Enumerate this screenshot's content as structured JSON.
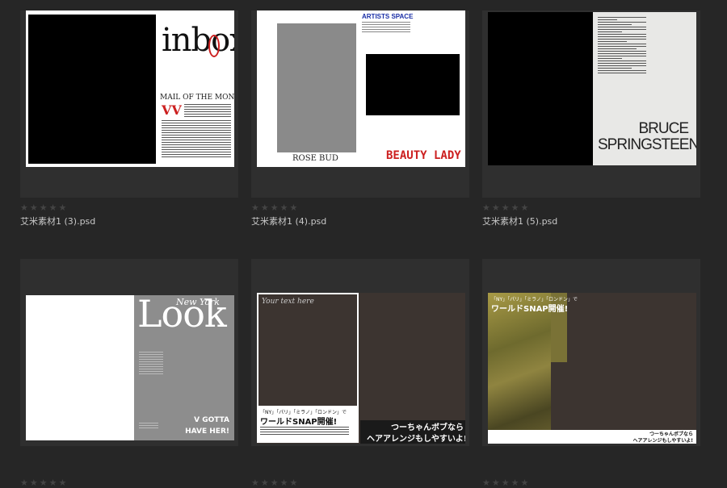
{
  "files": [
    {
      "name": "艾米素材1 (3).psd",
      "rating": "★★★★★"
    },
    {
      "name": "艾米素材1 (4).psd",
      "rating": "★★★★★"
    },
    {
      "name": "艾米素材1 (5).psd",
      "rating": "★★★★★"
    },
    {
      "name": "",
      "rating": "★★★★★"
    },
    {
      "name": "",
      "rating": "★★★★★"
    },
    {
      "name": "",
      "rating": "★★★★★"
    }
  ],
  "thumb1": {
    "title": "inbox",
    "subtitle": "MAIL OF THE MONTH"
  },
  "thumb2": {
    "header": "ARTISTS SPACE",
    "left_caption": "ROSE BUD",
    "right_caption": "BEAUTY LADY"
  },
  "thumb3": {
    "name_line1": "BRUCE",
    "name_line2": "SPRINGSTEEN"
  },
  "thumb4": {
    "script": "New York",
    "title": "Look",
    "tag_line1": "V GOTTA",
    "tag_line2": "HAVE HER!"
  },
  "thumb5": {
    "placeholder": "Your text here",
    "jp_small": "「NY」「パリ」「ミラノ」「ロンドン」で",
    "jp_large": "ワールドSNAP開催!",
    "jp_right1": "つーちゃんボブなら",
    "jp_right2": "ヘアアレンジもしやすいよ!"
  },
  "thumb6": {
    "jp_small": "「NY」「パリ」「ミラノ」「ロンドン」で",
    "jp_large": "ワールドSNAP開催!",
    "jp_right1": "つーちゃんボブなら",
    "jp_right2": "ヘアアレンジもしやすいよ!"
  },
  "colors": {
    "background": "#262626",
    "card": "#2f2f2f",
    "accent_red": "#cc1f1f",
    "accent_blue": "#1a2fa6"
  }
}
